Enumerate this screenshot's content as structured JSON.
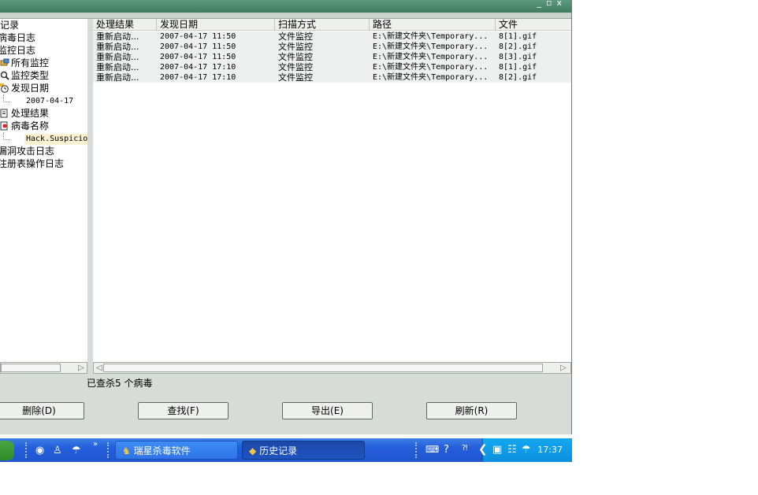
{
  "window": {
    "title_buttons": [
      "_",
      "▫",
      "x"
    ]
  },
  "tree": {
    "items": [
      {
        "label": "记录",
        "kind": "root"
      },
      {
        "label": "病毒日志",
        "kind": "root"
      },
      {
        "label": "监控日志",
        "kind": "root"
      },
      {
        "label": "所有监控",
        "kind": "child"
      },
      {
        "label": "监控类型",
        "kind": "child"
      },
      {
        "label": "发现日期",
        "kind": "child"
      },
      {
        "label": "2007-04-17",
        "kind": "leaf"
      },
      {
        "label": "处理结果",
        "kind": "child"
      },
      {
        "label": "病毒名称",
        "kind": "child"
      },
      {
        "label": "Hack.Suspicio",
        "kind": "leaf-selected"
      },
      {
        "label": "漏洞攻击日志",
        "kind": "root"
      },
      {
        "label": "注册表操作日志",
        "kind": "root"
      }
    ]
  },
  "table": {
    "columns": [
      "处理结果",
      "发现日期",
      "扫描方式",
      "路径",
      "文件"
    ],
    "rows": [
      [
        "重新启动...",
        "2007-04-17 11:50",
        "文件监控",
        "E:\\新建文件夹\\Temporary...",
        "8[1].gif"
      ],
      [
        "重新启动...",
        "2007-04-17 11:50",
        "文件监控",
        "E:\\新建文件夹\\Temporary...",
        "8[2].gif"
      ],
      [
        "重新启动...",
        "2007-04-17 11:50",
        "文件监控",
        "E:\\新建文件夹\\Temporary...",
        "8[3].gif"
      ],
      [
        "重新启动...",
        "2007-04-17 17:10",
        "文件监控",
        "E:\\新建文件夹\\Temporary...",
        "8[1].gif"
      ],
      [
        "重新启动...",
        "2007-04-17 17:10",
        "文件监控",
        "E:\\新建文件夹\\Temporary...",
        "8[2].gif"
      ]
    ]
  },
  "status": {
    "text": "已查杀5 个病毒"
  },
  "buttons": {
    "delete": "删除(D)",
    "find": "查找(F)",
    "export": "导出(E)",
    "refresh": "刷新(R)"
  },
  "taskbar": {
    "tasks": [
      "瑞星杀毒软件",
      "历史记录"
    ],
    "clock": "17:37"
  },
  "icons": {
    "tree_monitor": "monitor-icon",
    "tree_search": "magnifier-icon",
    "tree_date": "clock-icon",
    "tree_result": "document-icon",
    "tree_virus": "virus-icon"
  },
  "colors": {
    "taskbar": "#245edb",
    "tray": "#0c8fe0",
    "selected_bg": "#fbf0cf"
  }
}
